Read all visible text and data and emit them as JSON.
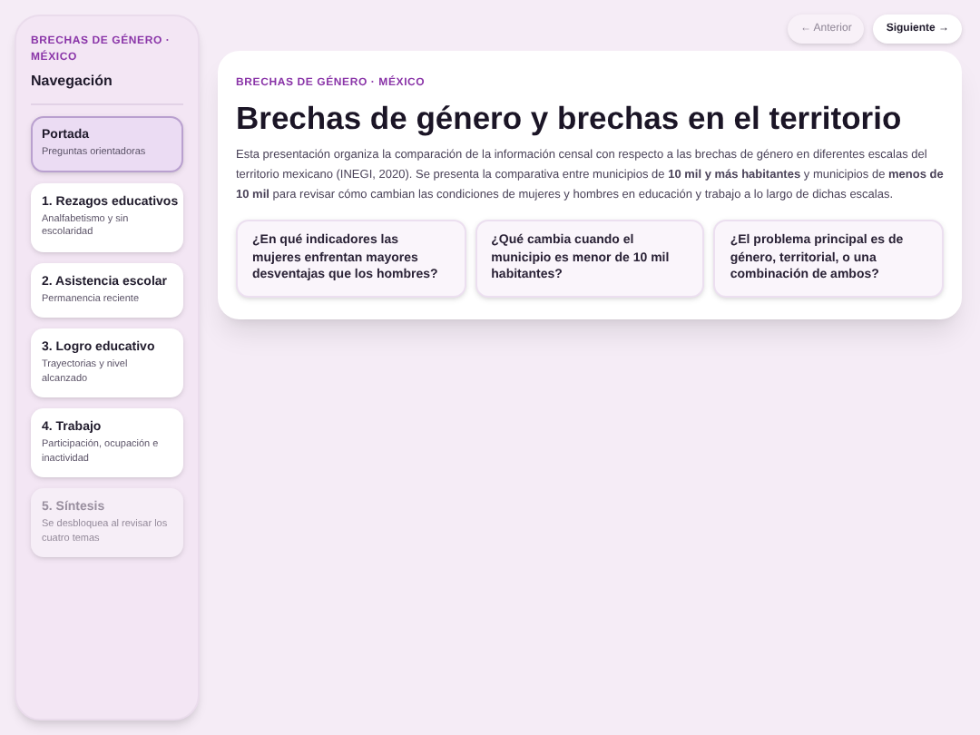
{
  "sidebar": {
    "eyebrow": "BRECHAS DE GÉNERO · MÉXICO",
    "title": "Navegación",
    "items": [
      {
        "title": "Portada",
        "subtitle": "Preguntas orientadoras",
        "selected": true,
        "disabled": false
      },
      {
        "title": "1. Rezagos educativos",
        "subtitle": "Analfabetismo y sin escolaridad",
        "selected": false,
        "disabled": false
      },
      {
        "title": "2. Asistencia escolar",
        "subtitle": "Permanencia reciente",
        "selected": false,
        "disabled": false
      },
      {
        "title": "3. Logro educativo",
        "subtitle": "Trayectorias y nivel alcanzado",
        "selected": false,
        "disabled": false
      },
      {
        "title": "4. Trabajo",
        "subtitle": "Participación, ocupación e inactividad",
        "selected": false,
        "disabled": false
      },
      {
        "title": "5. Síntesis",
        "subtitle": "Se desbloquea al revisar los cuatro temas",
        "selected": false,
        "disabled": true
      }
    ]
  },
  "pager": [
    {
      "label": "← Anterior",
      "disabled": true
    },
    {
      "label": "Siguiente →",
      "disabled": false
    }
  ],
  "card": {
    "eyebrow": "BRECHAS DE GÉNERO · MÉXICO",
    "title": "Brechas de género y brechas en el territorio",
    "body": "Esta presentación organiza la comparación de la información censal con respecto a las brechas de género en diferentes escalas del territorio mexicano (INEGI, 2020). Se presenta la comparativa entre municipios de **10 mil y más habitantes** y municipios de **menos de 10 mil** para revisar cómo cambian las condiciones de mujeres y hombres en educación y trabajo a lo largo de dichas escalas.",
    "questions": [
      "¿En qué indicadores las mujeres enfrentan mayores desventajas que los hombres?",
      "¿Qué cambia cuando el municipio es menor de 10 mil habitantes?",
      "¿El problema principal es de género, territorial, o una combinación de ambos?"
    ]
  }
}
